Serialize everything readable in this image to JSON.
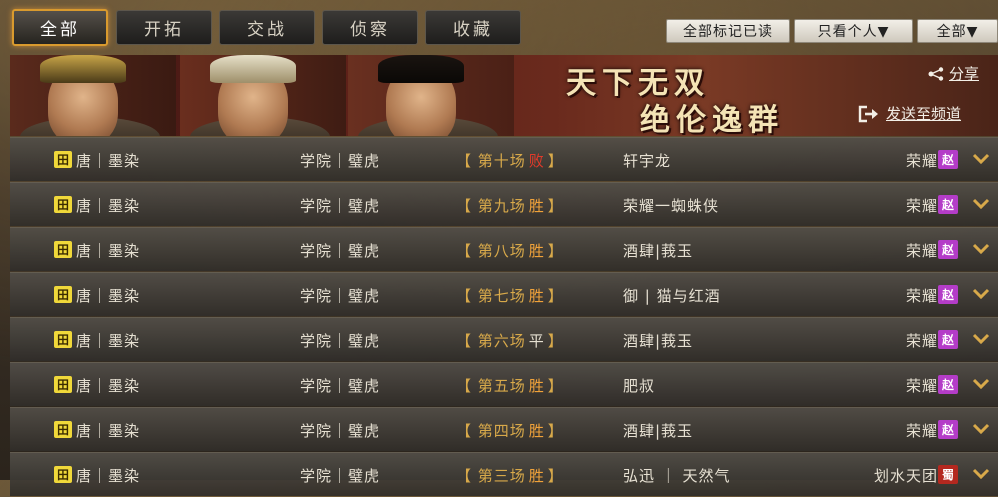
{
  "tabs": [
    {
      "label": "全部",
      "active": true
    },
    {
      "label": "开拓",
      "active": false
    },
    {
      "label": "交战",
      "active": false
    },
    {
      "label": "侦察",
      "active": false
    },
    {
      "label": "收藏",
      "active": false
    }
  ],
  "controls": {
    "mark_all_read": "全部标记已读",
    "filter_personal": "只看个人▼",
    "filter_all": "全部▼"
  },
  "banner": {
    "slogan_line1": "天下无双",
    "slogan_line2": "绝伦逸群",
    "share_label": "分享",
    "send_label": "发送至频道"
  },
  "colors": {
    "badge_yellow": "#f0d83a",
    "server_purple": "#b43cc8",
    "server_red": "#b4281f",
    "result_win": "#f0a23a",
    "result_lose": "#e23a2a",
    "tab_active_border": "#d99a2e"
  },
  "rows": [
    {
      "badge": "田",
      "team_a": "唐｜墨染",
      "team_b": "学院｜璧虎",
      "match_prefix": "【 第十场",
      "result": "败",
      "result_type": "lose",
      "match_suffix": "】",
      "player": "轩宇龙",
      "alliance": "荣耀",
      "server": "赵",
      "server_type": "zhao"
    },
    {
      "badge": "田",
      "team_a": "唐｜墨染",
      "team_b": "学院｜璧虎",
      "match_prefix": "【 第九场",
      "result": "胜",
      "result_type": "win",
      "match_suffix": "】",
      "player": "荣耀一蜘蛛侠",
      "alliance": "荣耀",
      "server": "赵",
      "server_type": "zhao"
    },
    {
      "badge": "田",
      "team_a": "唐｜墨染",
      "team_b": "学院｜璧虎",
      "match_prefix": "【 第八场",
      "result": "胜",
      "result_type": "win",
      "match_suffix": "】",
      "player": "酒肆|莪玉",
      "alliance": "荣耀",
      "server": "赵",
      "server_type": "zhao"
    },
    {
      "badge": "田",
      "team_a": "唐｜墨染",
      "team_b": "学院｜璧虎",
      "match_prefix": "【 第七场",
      "result": "胜",
      "result_type": "win",
      "match_suffix": "】",
      "player": "御 | 猫与红酒",
      "alliance": "荣耀",
      "server": "赵",
      "server_type": "zhao"
    },
    {
      "badge": "田",
      "team_a": "唐｜墨染",
      "team_b": "学院｜璧虎",
      "match_prefix": "【 第六场",
      "result": "平",
      "result_type": "draw",
      "match_suffix": "】",
      "player": "酒肆|莪玉",
      "alliance": "荣耀",
      "server": "赵",
      "server_type": "zhao"
    },
    {
      "badge": "田",
      "team_a": "唐｜墨染",
      "team_b": "学院｜璧虎",
      "match_prefix": "【 第五场",
      "result": "胜",
      "result_type": "win",
      "match_suffix": "】",
      "player": "肥叔",
      "alliance": "荣耀",
      "server": "赵",
      "server_type": "zhao"
    },
    {
      "badge": "田",
      "team_a": "唐｜墨染",
      "team_b": "学院｜璧虎",
      "match_prefix": "【 第四场",
      "result": "胜",
      "result_type": "win",
      "match_suffix": "】",
      "player": "酒肆|莪玉",
      "alliance": "荣耀",
      "server": "赵",
      "server_type": "zhao"
    },
    {
      "badge": "田",
      "team_a": "唐｜墨染",
      "team_b": "学院｜璧虎",
      "match_prefix": "【 第三场",
      "result": "胜",
      "result_type": "win",
      "match_suffix": "】",
      "player": "弘迅 ｜ 天然气",
      "alliance": "划水天团",
      "server": "蜀",
      "server_type": "shu"
    }
  ]
}
